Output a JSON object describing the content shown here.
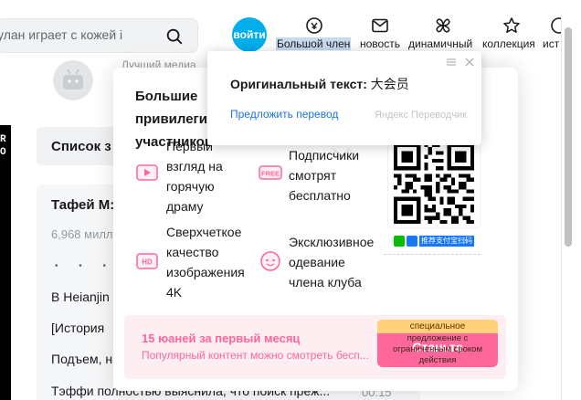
{
  "header": {
    "search": {
      "value": "улан играет с кожей i"
    },
    "login_label": "войти",
    "nav": [
      {
        "label": "Большой член",
        "icon": "big-member-icon",
        "highlighted": true
      },
      {
        "label": "новость",
        "icon": "message-icon"
      },
      {
        "label": "динамичный",
        "icon": "dynamic-icon"
      },
      {
        "label": "коллекция",
        "icon": "star-icon"
      },
      {
        "label": "ист",
        "icon": "history-icon"
      }
    ]
  },
  "background": {
    "under_popup_text": "Лучший медиа",
    "video_letters": "R\nO",
    "list_header": "Список з",
    "playlist": {
      "title": "Тафей М:",
      "views": "6,968 милл",
      "rows": [
        "В Heianjin",
        "[История",
        "Подъем, н",
        "Тэффи полностью выяснила, что поиск преж..."
      ],
      "last_time": "00:15"
    }
  },
  "vip_popup": {
    "title": "Большие привилегии участников",
    "perks": [
      {
        "icon": "first-look-icon",
        "text": "Первый взгляд на горячую драму"
      },
      {
        "icon": "free-icon",
        "text": "Подписчики смотрят бесплатно",
        "icon_label": "FREE"
      },
      {
        "icon": "hd-icon",
        "text": "Сверхчеткое качество изображения 4K",
        "icon_label": "HD"
      },
      {
        "icon": "costume-icon",
        "text": "Эксклюзивное одевание члена клуба"
      }
    ],
    "pay_label": "推荐支付宝扫码",
    "promo": {
      "price": "15 юаней за первый месяц",
      "desc": "Популярный контент можно смотреть бесп...",
      "badge_top": "специальное",
      "badge_rest": "предложение с ограниченным сроком действия",
      "button": "Станьте"
    }
  },
  "translator": {
    "original_label": "Оригинальный текст:",
    "original_value": "大会员",
    "suggest_link": "Предложить перевод",
    "brand": "Яндекс Переводчик"
  },
  "colors": {
    "accent_blue": "#00aeec",
    "pink": "#ff6699",
    "link": "#1a73e8",
    "highlight": "#c7dbef"
  }
}
